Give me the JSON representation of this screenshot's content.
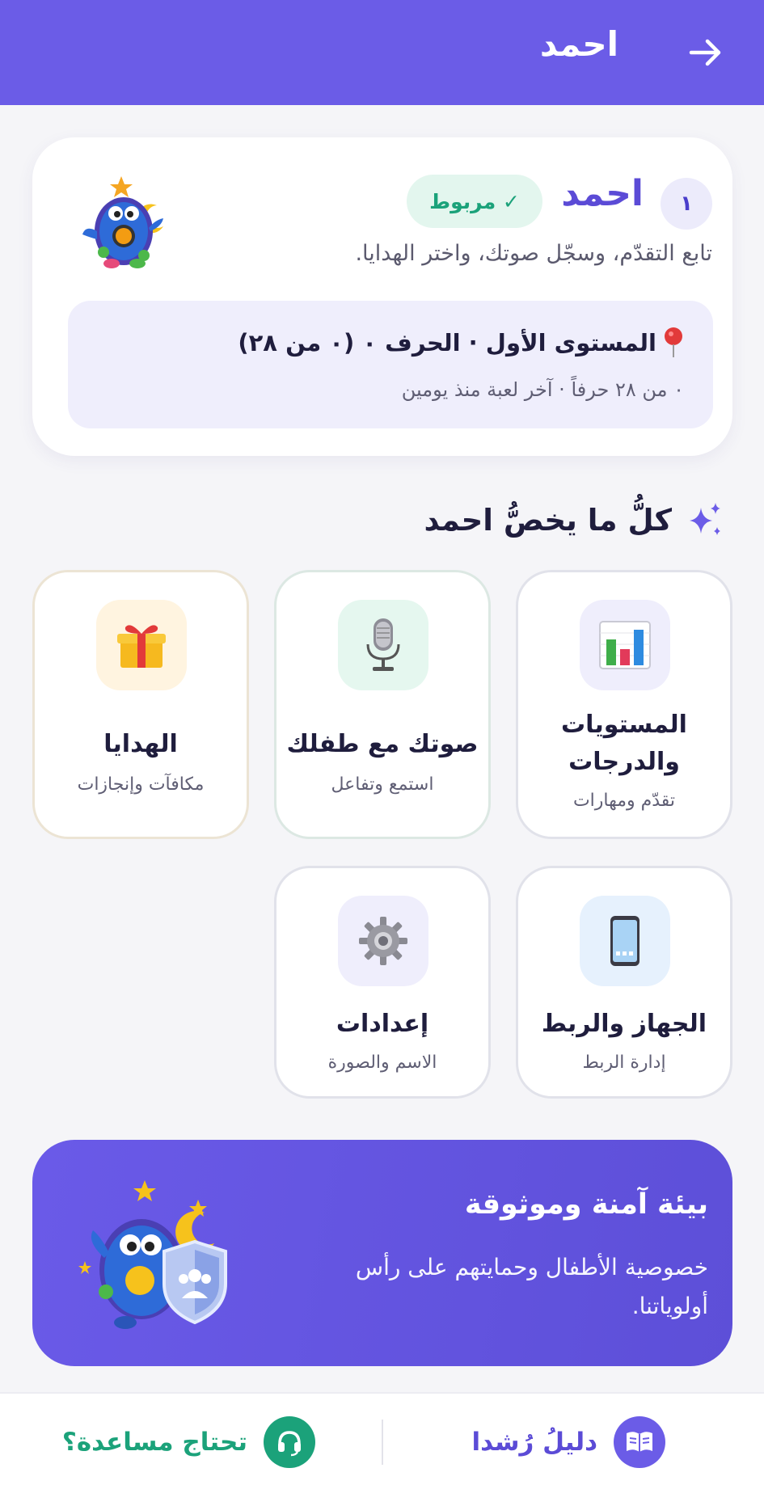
{
  "header": {
    "title": "احمد",
    "back_icon": "arrow-right-icon"
  },
  "profile": {
    "index": "١",
    "name": "احمد",
    "linked_label": "✓ مربوط",
    "subtitle": "تابع التقدّم، وسجّل صوتك، واختر الهدايا.",
    "level_title": "المستوى الأول · الحرف ٠ (٠ من ٢٨)",
    "level_sub": "٠ من ٢٨ حرفاً · آخر لعبة منذ يومين"
  },
  "section": {
    "title": "كلُّ ما يخصُّ احمد",
    "icon": "sparkle-icon"
  },
  "tiles": [
    {
      "title": "المستويات والدرجات",
      "subtitle": "تقدّم ومهارات",
      "icon": "bar-chart-icon"
    },
    {
      "title": "صوتك مع طفلك",
      "subtitle": "استمع وتفاعل",
      "icon": "microphone-icon"
    },
    {
      "title": "الهدايا",
      "subtitle": "مكافآت وإنجازات",
      "icon": "gift-icon"
    },
    {
      "title": "الجهاز والربط",
      "subtitle": "إدارة الربط",
      "icon": "phone-icon"
    },
    {
      "title": "إعدادات",
      "subtitle": "الاسم والصورة",
      "icon": "gear-icon"
    }
  ],
  "banner": {
    "title": "بيئة آمنة وموثوقة",
    "subtitle": "خصوصية الأطفال وحمايتهم على رأس أولوياتنا."
  },
  "bottom": {
    "guide_label": "دليلُ رُشدا",
    "help_label": "تحتاج مساعدة؟"
  },
  "colors": {
    "primary": "#6b5ce7",
    "success": "#1ba27a",
    "background": "#f5f5f8"
  }
}
